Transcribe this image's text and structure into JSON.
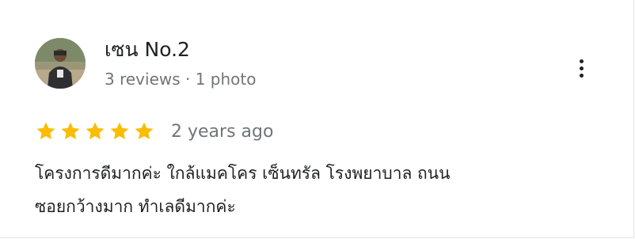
{
  "reviewer": {
    "name": "เซน No.2",
    "meta": "3 reviews · 1 photo"
  },
  "more_options": {
    "icon": "more-vert-icon"
  },
  "rating": {
    "stars": 5,
    "max": 5,
    "star_color": "#fbbc04"
  },
  "review": {
    "time": "2 years ago",
    "lines": [
      "โครงการดีมากค่ะ ใกล้แมคโคร เซ็นทรัล โรงพยาบาล ถนน",
      "ซอยกว้างมาก ทำเลดีมากค่ะ"
    ]
  }
}
